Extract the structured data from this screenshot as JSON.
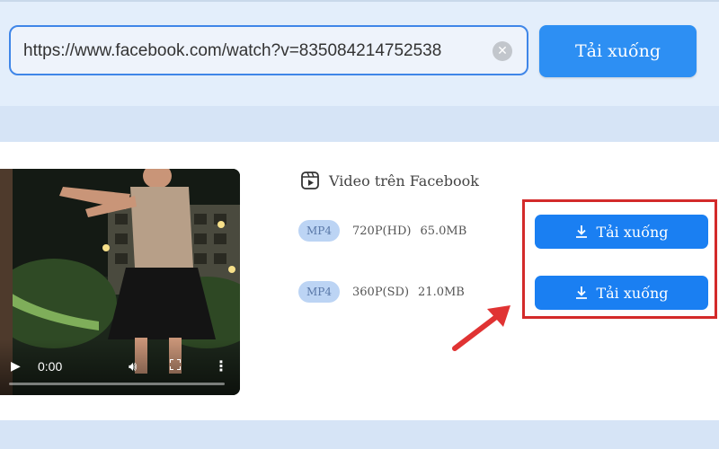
{
  "search": {
    "url_value": "https://www.facebook.com/watch?v=835084214752538",
    "clear_icon": "close-circle-icon",
    "download_label": "Tải xuống"
  },
  "video": {
    "play_icon": "play-icon",
    "current_time": "0:00",
    "progress": 0,
    "volume_icon": "volume-icon",
    "fullscreen_icon": "fullscreen-icon",
    "more_icon": "more-vertical-icon"
  },
  "result": {
    "platform_icon": "video-reel-icon",
    "platform_label": "Video trên Facebook",
    "formats": [
      {
        "badge": "MP4",
        "resolution": "720P(HD)",
        "size": "65.0MB",
        "button_label": "Tải xuống"
      },
      {
        "badge": "MP4",
        "resolution": "360P(SD)",
        "size": "21.0MB",
        "button_label": "Tải xuống"
      }
    ]
  },
  "annotations": {
    "highlight_color": "#d32a2a",
    "arrow_color": "#e03333"
  },
  "colors": {
    "accent": "#1a7ff2",
    "background": "#dbe8f8",
    "badge": "#bcd4f4"
  }
}
